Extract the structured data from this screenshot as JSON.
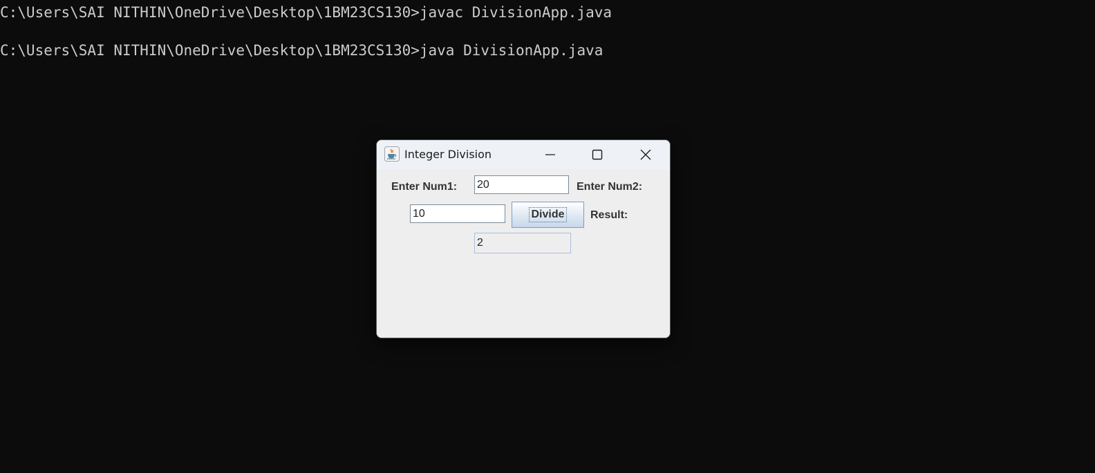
{
  "terminal": {
    "lines": [
      "C:\\Users\\SAI NITHIN\\OneDrive\\Desktop\\1BM23CS130>javac DivisionApp.java",
      "C:\\Users\\SAI NITHIN\\OneDrive\\Desktop\\1BM23CS130>java DivisionApp.java"
    ],
    "background": "#0c0c0c",
    "text_color": "#cccccc"
  },
  "window": {
    "title": "Integer Division",
    "icon": "java-coffee-cup-icon",
    "controls": {
      "minimize": "minimize-icon",
      "maximize": "maximize-icon",
      "close": "close-icon"
    }
  },
  "form": {
    "num1_label": "Enter Num1:",
    "num1_value": "20",
    "num2_label": "Enter Num2:",
    "num2_value": "10",
    "divide_label": "Divide",
    "result_label": "Result:",
    "result_value": "2"
  },
  "colors": {
    "window_bg": "#eeeeee",
    "titlebar_bg": "#eef1f6",
    "button_border": "#7a9cc0"
  }
}
